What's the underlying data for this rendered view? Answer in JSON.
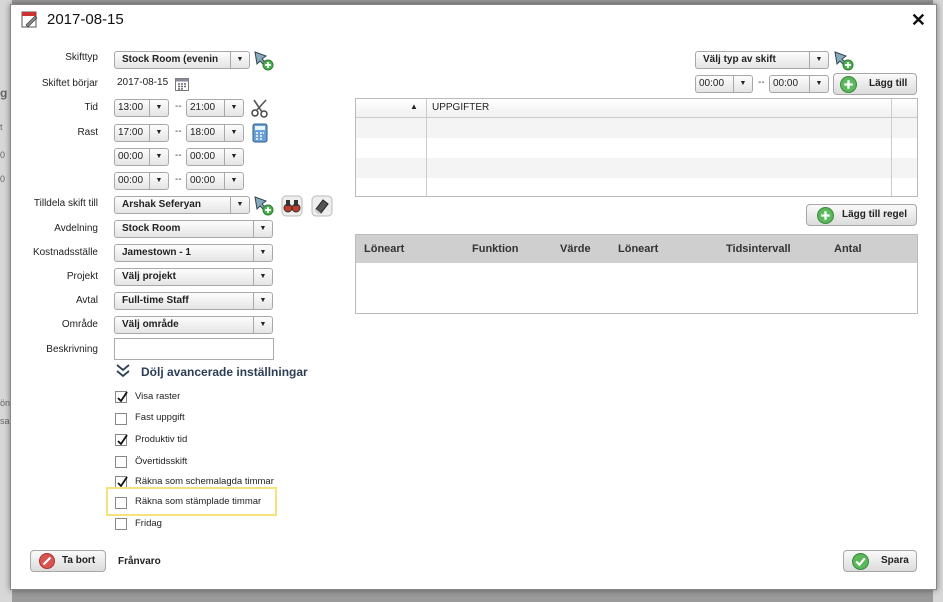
{
  "title": "2017-08-15",
  "background": {
    "nav_date": "2017-08-15",
    "side_fragments": [
      "g",
      "t",
      "0",
      "0",
      "ön",
      "sa"
    ]
  },
  "form": {
    "shift_type": {
      "label": "Skifttyp",
      "value": "Stock Room (evenin"
    },
    "shift_start": {
      "label": "Skiftet börjar",
      "value": "2017-08-15"
    },
    "time": {
      "label": "Tid",
      "from": "13:00",
      "to": "21:00"
    },
    "break": {
      "label": "Rast",
      "rows": [
        {
          "from": "17:00",
          "to": "18:00"
        },
        {
          "from": "00:00",
          "to": "00:00"
        },
        {
          "from": "00:00",
          "to": "00:00"
        }
      ]
    },
    "assign": {
      "label": "Tilldela skift till",
      "value": "Arshak Seferyan"
    },
    "department": {
      "label": "Avdelning",
      "value": "Stock Room"
    },
    "cost_center": {
      "label": "Kostnadsställe",
      "value": "Jamestown - 1"
    },
    "project": {
      "label": "Projekt",
      "value": "Välj projekt"
    },
    "agreement": {
      "label": "Avtal",
      "value": "Full-time Staff"
    },
    "area": {
      "label": "Område",
      "value": "Välj område"
    },
    "description": {
      "label": "Beskrivning",
      "value": ""
    },
    "dash": "--"
  },
  "advanced": {
    "toggle_label": "Dölj avancerade inställningar",
    "options": [
      {
        "label": "Visa raster",
        "checked": true
      },
      {
        "label": "Fast uppgift",
        "checked": false
      },
      {
        "label": "Produktiv tid",
        "checked": true
      },
      {
        "label": "Övertidsskift",
        "checked": false
      },
      {
        "label": "Räkna som schemalagda timmar",
        "checked": true
      },
      {
        "label": "Räkna som stämplade timmar",
        "checked": false
      },
      {
        "label": "Fridag",
        "checked": false
      }
    ]
  },
  "tasks": {
    "type_select": "Välj typ av skift",
    "from": "00:00",
    "to": "00:00",
    "add_label": "Lägg till",
    "column": "UPPGIFTER",
    "sort_glyph": "▲"
  },
  "rules": {
    "add_label": "Lägg till regel",
    "columns": [
      "Löneart",
      "Funktion",
      "Värde",
      "Löneart",
      "Tidsintervall",
      "Antal"
    ]
  },
  "footer": {
    "delete_label": "Ta bort",
    "absence_label": "Frånvaro",
    "save_label": "Spara"
  },
  "colors": {
    "accent_green": "#5cb85c",
    "delete_red": "#d9534f",
    "highlight": "#f4e37a",
    "heading": "#2c3e55"
  }
}
